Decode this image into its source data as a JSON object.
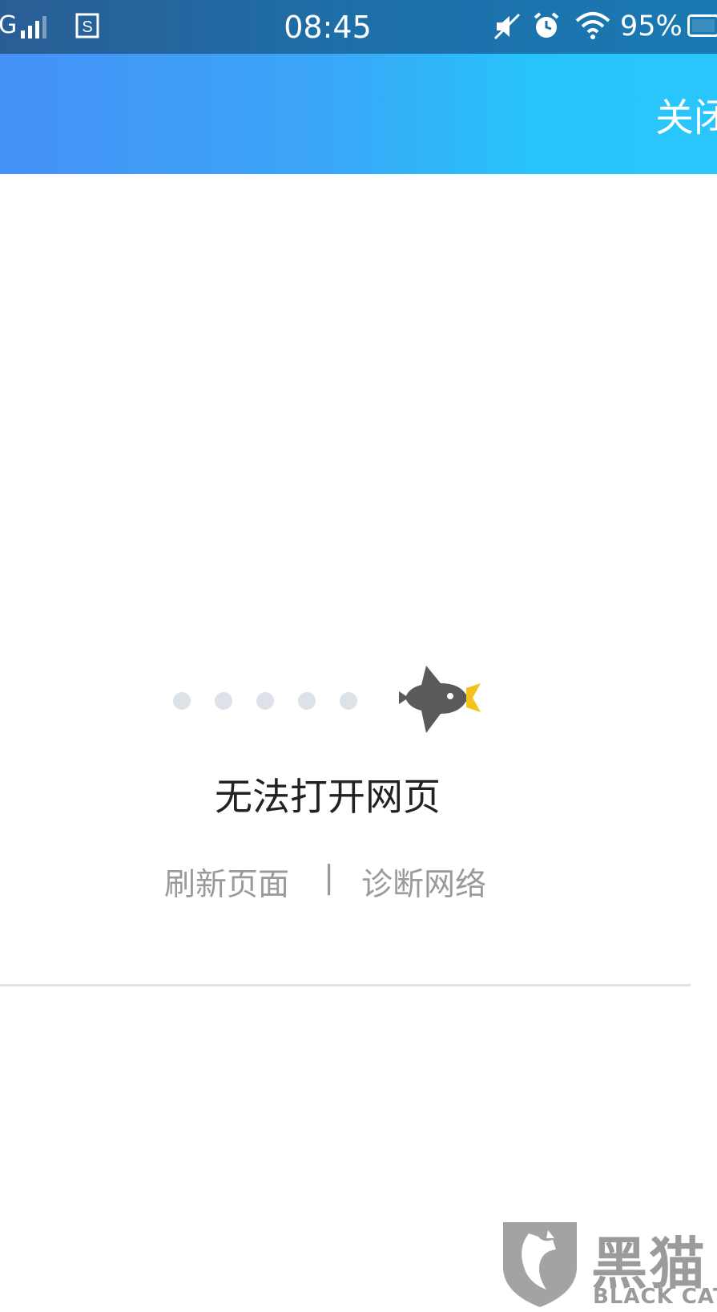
{
  "status_bar": {
    "network": "G",
    "time": "08:45",
    "battery_percent": "95%",
    "icons": [
      "signal-bars-icon",
      "sim-s-icon",
      "mute-icon",
      "alarm-icon",
      "wifi-icon",
      "battery-icon"
    ]
  },
  "header": {
    "close_label": "关闭",
    "gradient_start": "#4591f6",
    "gradient_end": "#27c4fb"
  },
  "error": {
    "title": "无法打开网页",
    "refresh_label": "刷新页面",
    "separator": "|",
    "diagnose_label": "诊断网络",
    "loading_dot_count": 5,
    "illustration_icon": "bird-icon"
  },
  "watermark": {
    "text_cn": "黑猫",
    "text_en": "BLACK CAT"
  }
}
